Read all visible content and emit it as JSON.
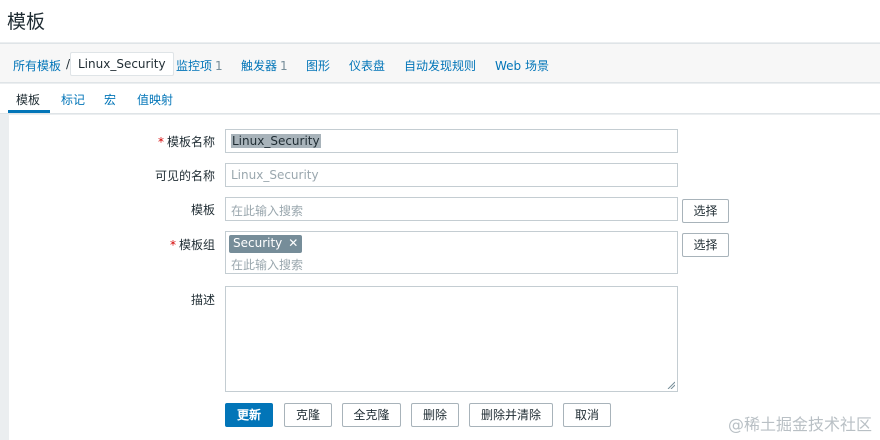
{
  "page": {
    "title": "模板"
  },
  "breadcrumb": {
    "all_templates": "所有模板",
    "separator": "/",
    "current": "Linux_Security"
  },
  "nav": [
    {
      "label": "监控项",
      "count": "1"
    },
    {
      "label": "触发器",
      "count": "1"
    },
    {
      "label": "图形",
      "count": ""
    },
    {
      "label": "仪表盘",
      "count": ""
    },
    {
      "label": "自动发现规则",
      "count": ""
    },
    {
      "label": "Web 场景",
      "count": ""
    }
  ],
  "tabs": [
    {
      "label": "模板",
      "active": true
    },
    {
      "label": "标记",
      "active": false
    },
    {
      "label": "宏",
      "active": false
    },
    {
      "label": "值映射",
      "active": false
    }
  ],
  "form": {
    "required_mark": "*",
    "template_name": {
      "label": "模板名称",
      "value": "Linux_Security"
    },
    "visible_name": {
      "label": "可见的名称",
      "placeholder": "Linux_Security"
    },
    "templates": {
      "label": "模板",
      "placeholder": "在此输入搜索",
      "select_label": "选择"
    },
    "groups": {
      "label": "模板组",
      "chip": "Security",
      "chip_remove": "✕",
      "placeholder": "在此输入搜索",
      "select_label": "选择"
    },
    "description": {
      "label": "描述",
      "value": ""
    }
  },
  "actions": {
    "update": "更新",
    "clone": "克隆",
    "full_clone": "全克隆",
    "delete": "删除",
    "delete_and_clear": "删除并清除",
    "cancel": "取消"
  },
  "watermark": "@稀土掘金技术社区",
  "colors": {
    "accent": "#0275b8",
    "required": "#d40000"
  }
}
